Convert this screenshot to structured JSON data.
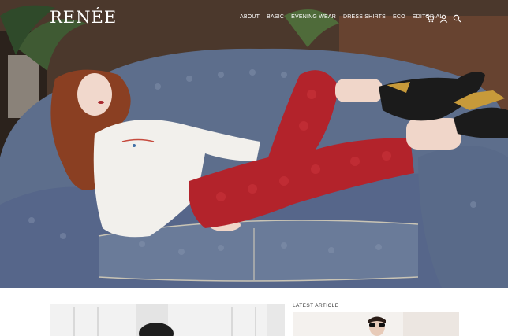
{
  "brand": {
    "logo_text": "RENÉE"
  },
  "nav": {
    "items": [
      {
        "label": "ABOUT"
      },
      {
        "label": "BASIC"
      },
      {
        "label": "EVENING WEAR"
      },
      {
        "label": "DRESS SHIRTS"
      },
      {
        "label": "ECO"
      },
      {
        "label": "EDITORIAL"
      }
    ],
    "icons": [
      "cart-icon",
      "user-icon",
      "search-icon"
    ]
  },
  "latest": {
    "label": "LATEST  ARTICLE"
  },
  "colors": {
    "text_light": "#ffffff",
    "sofa": "#5f6f8c",
    "trousers": "#b3232b",
    "boots": "#1b1b1b"
  }
}
